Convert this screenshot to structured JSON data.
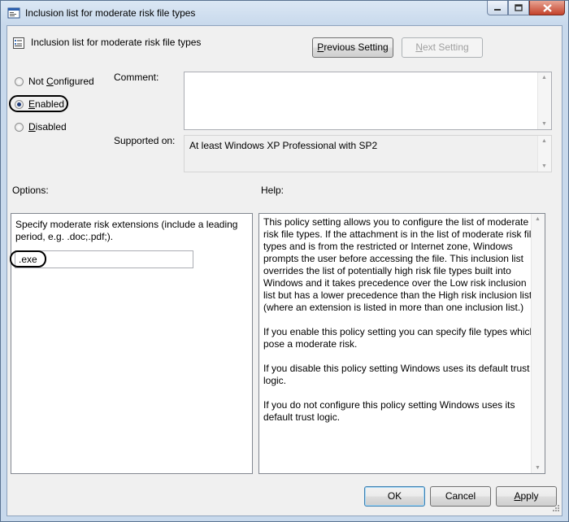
{
  "window": {
    "title": "Inclusion list for moderate risk file types"
  },
  "header": {
    "setting_title": "Inclusion list for moderate risk file types",
    "previous_label": "Previous Setting",
    "next_label": "Next Setting"
  },
  "state": {
    "options": [
      {
        "label": "Not Configured",
        "selected": false
      },
      {
        "label": "Enabled",
        "selected": true
      },
      {
        "label": "Disabled",
        "selected": false
      }
    ]
  },
  "comment": {
    "label": "Comment:",
    "value": ""
  },
  "supported": {
    "label": "Supported on:",
    "value": "At least Windows XP Professional with SP2"
  },
  "options_section": {
    "label": "Options:",
    "description": "Specify moderate risk extensions (include a leading period, e.g. .doc;.pdf;).",
    "extensions_value": ".exe"
  },
  "help_section": {
    "label": "Help:",
    "paragraphs": [
      "This policy setting allows you to configure the list of moderate risk file types. If the attachment is in the list of moderate risk file types and is from the restricted or Internet zone, Windows prompts the user before accessing the file. This inclusion list overrides the list of potentially high risk file types built into Windows and it takes precedence over the Low risk inclusion list but has a lower precedence than the High risk inclusion list (where an extension is listed in more than one inclusion list.)",
      "If you enable this policy setting you can specify file types which pose a moderate risk.",
      "If you disable this policy setting Windows uses its default trust logic.",
      "If you do not configure this policy setting Windows uses its default trust logic."
    ]
  },
  "footer": {
    "ok_label": "OK",
    "cancel_label": "Cancel",
    "apply_label": "Apply"
  },
  "icons": {
    "window": "policy-window-icon",
    "setting": "policy-setting-icon",
    "minimize": "minimize-icon",
    "maximize": "maximize-icon",
    "close": "close-icon"
  }
}
